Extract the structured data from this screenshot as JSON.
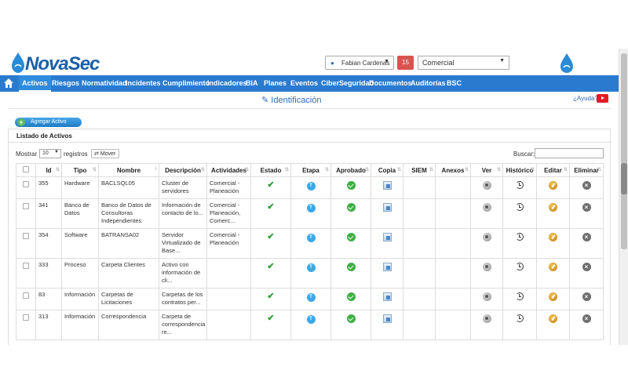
{
  "header": {
    "logo_text": "NovaSec",
    "user_name": "Fabian Cardenas",
    "notification_count": "15",
    "company": "Comercial"
  },
  "nav": {
    "items": [
      {
        "label": "Activos",
        "active": true
      },
      {
        "label": "Riesgos"
      },
      {
        "label": "Normatividad"
      },
      {
        "label": "Incidentes"
      },
      {
        "label": "Cumplimiento"
      },
      {
        "label": "Indicadores"
      },
      {
        "label": "BIA"
      },
      {
        "label": "Planes"
      },
      {
        "label": "Eventos"
      },
      {
        "label": "CiberSeguridad"
      },
      {
        "label": "Documentos"
      },
      {
        "label": "Auditorías"
      },
      {
        "label": "BSC"
      }
    ]
  },
  "page": {
    "title": "Identificación",
    "help_label": "¿Ayuda?",
    "add_button": "Agregar Activo",
    "panel_title": "Listado de Activos",
    "show_label": "Mostrar",
    "show_value": "10",
    "records_label": "registros",
    "move_button": "Mover",
    "search_label": "Buscar:",
    "search_value": ""
  },
  "table": {
    "headers": [
      "",
      "Id",
      "Tipo",
      "Nombre",
      "Descripción",
      "Actividades",
      "Estado",
      "Etapa",
      "Aprobado",
      "Copia",
      "SIEM",
      "Anexos",
      "Ver",
      "Histórico",
      "Editar",
      "Eliminar"
    ],
    "etapa_label": "T",
    "rows": [
      {
        "id": "355",
        "tipo": "Hardware",
        "nombre": "BACLSQL05",
        "descripcion": "Cluster de servidores",
        "actividades": "Comercial - Planeación"
      },
      {
        "id": "341",
        "tipo": "Banco de Datos",
        "nombre": "Banco de Datos de Consultoras Independientes",
        "descripcion": "Información de contacto de lo...",
        "actividades": "Comercial - Planeación, Comerc..."
      },
      {
        "id": "354",
        "tipo": "Software",
        "nombre": "BATRANSA02",
        "descripcion": "Servidor Virtualizado de Base...",
        "actividades": "Comercial - Planeación"
      },
      {
        "id": "333",
        "tipo": "Proceso",
        "nombre": "Carpeta Clientes",
        "descripcion": "Activo con información de cli...",
        "actividades": ""
      },
      {
        "id": "83",
        "tipo": "Información",
        "nombre": "Carpetas de Licitaciones",
        "descripcion": "Carpetas de los contratos per...",
        "actividades": ""
      },
      {
        "id": "313",
        "tipo": "Información",
        "nombre": "Correspondencia",
        "descripcion": "Carpeta de correspondencia re...",
        "actividades": ""
      }
    ]
  }
}
